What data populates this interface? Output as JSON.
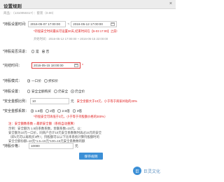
{
  "dialog": {
    "title": "设置规则",
    "close": "×",
    "subtitle": "商品：（1310050417）：套装（0.00）"
  },
  "time": {
    "label": "*持股设置时间:",
    "start": "2016-05-07 17:00:00",
    "end": "2016-05-12 17:00:00",
    "note": "*持股安全时间最长可设置30天,结束时间在【6-03 17:00】之前!",
    "hint": "开始时间：2016-05-12 17:00:00 ~ 2016-05-15 22:00:00"
  },
  "stock": {
    "label": "*持股是否清退：",
    "opt_yes": "是",
    "opt_no": "否"
  },
  "end_time": {
    "label": "*完结时间：",
    "value": "2016-05-15 18:00:00",
    "note": "*"
  },
  "mode": {
    "label": "*持股模式：",
    "opt1": "一口价",
    "opt2": "折扣价"
  },
  "type": {
    "label": "*持股设置：",
    "opt1": "安全全额购买",
    "opt2": "仍安全",
    "opt3": "仍全价"
  },
  "amount": {
    "label": "*安全金额比例：",
    "value": "10",
    "unit": "元",
    "note": "安全金额大于10元、小于等于商家补贴的20%"
  },
  "ratio": {
    "label": "*安全金额系数：",
    "opt1": "1.5倍",
    "opt2": "2倍",
    "opt3": "2.5倍",
    "opt4": "3倍",
    "note": "*持股安全可再低于3元，小于等于持股额价格的300%）"
  },
  "info": {
    "line1": "注：安全额数系数 = 最新安全额（系统自动重算）",
    "line2": "示例：安全额为 1.5倍系数系数，金额系数=15元，以：",
    "line3": "安全额为10元一口价，同商户合计10元安全系数数时再过15元的安全",
    "line4": "（即1元可以再购买3件）；持股额可以以下比率系统计算持股额时的",
    "line5": "安全全额份额=10元*1.5=15元*100=15元安全系数数的额"
  },
  "price": {
    "label": "*持股价格：",
    "value": "10000",
    "unit": "元"
  },
  "actions": {
    "save": "保存规则"
  },
  "watermark": {
    "logo_text": "巨",
    "text": "巨灵文化"
  }
}
